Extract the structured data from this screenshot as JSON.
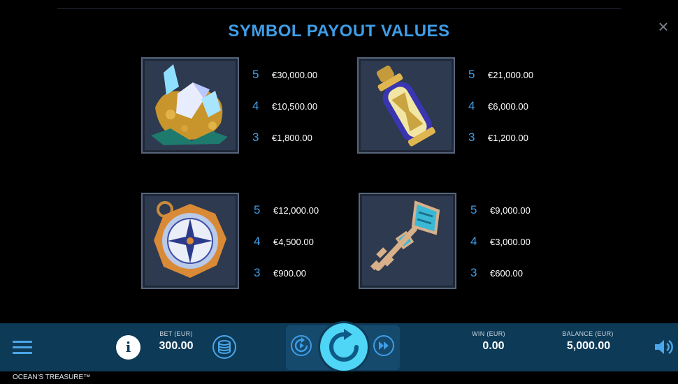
{
  "title": "SYMBOL PAYOUT VALUES",
  "close_label": "×",
  "symbols": [
    {
      "name": "crystals-gold",
      "payouts": [
        {
          "count": "5",
          "value": "€30,000.00"
        },
        {
          "count": "4",
          "value": "€10,500.00"
        },
        {
          "count": "3",
          "value": "€1,800.00"
        }
      ]
    },
    {
      "name": "hourglass-bottle",
      "payouts": [
        {
          "count": "5",
          "value": "€21,000.00"
        },
        {
          "count": "4",
          "value": "€6,000.00"
        },
        {
          "count": "3",
          "value": "€1,200.00"
        }
      ]
    },
    {
      "name": "compass",
      "payouts": [
        {
          "count": "5",
          "value": "€12,000.00"
        },
        {
          "count": "4",
          "value": "€4,500.00"
        },
        {
          "count": "3",
          "value": "€900.00"
        }
      ]
    },
    {
      "name": "key",
      "payouts": [
        {
          "count": "5",
          "value": "€9,000.00"
        },
        {
          "count": "4",
          "value": "€3,000.00"
        },
        {
          "count": "3",
          "value": "€600.00"
        }
      ]
    }
  ],
  "bottom_bar": {
    "info_label": "i",
    "bet_label": "BET (EUR)",
    "bet_value": "300.00",
    "win_label": "WIN (EUR)",
    "win_value": "0.00",
    "balance_label": "BALANCE (EUR)",
    "balance_value": "5,000.00"
  },
  "game_title": "OCEAN'S TREASURE™",
  "colors": {
    "accent": "#3f9de6",
    "bar": "#0d3a57",
    "spin": "#4fd5f5",
    "tile": "#2d3a4f"
  }
}
